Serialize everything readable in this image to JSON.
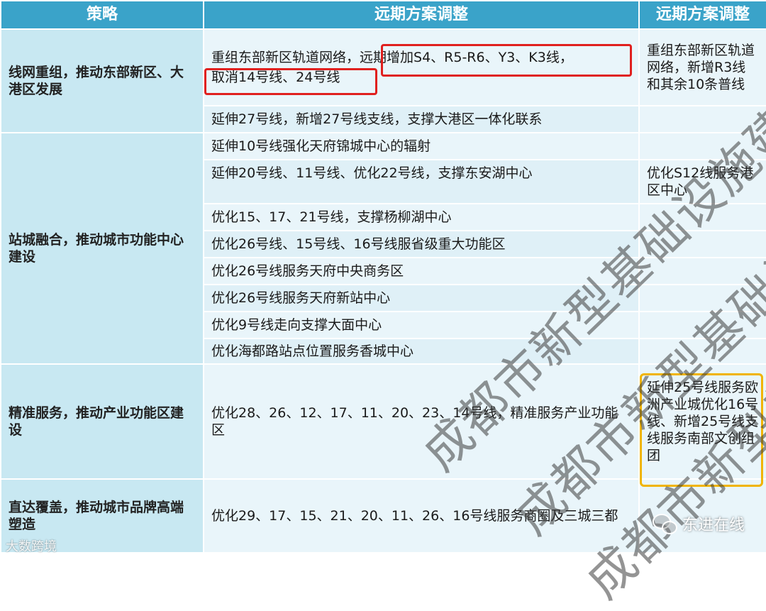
{
  "header": {
    "col1": "策略",
    "col2": "远期方案调整",
    "col3": "远期方案调整"
  },
  "sections": [
    {
      "strategy": "线网重组，推动东部新区、大港区发展",
      "rows": [
        {
          "mid_a": "重组东部新区轨道网络，",
          "mid_b": "远期增加S4、R5-R6、Y3、K3线，",
          "mid_c": "取消14号线、24号线"
        },
        {
          "mid": "延伸27号线，新增27号线支线，支撑大港区一体化联系"
        }
      ],
      "right": "重组东部新区轨道网络，新增R3线和其余10条普线"
    },
    {
      "strategy": "站城融合，推动城市功能中心建设",
      "rows": [
        {
          "mid": "延伸10号线强化天府锦城中心的辐射",
          "right": ""
        },
        {
          "mid": "延伸20号线、11号线、优化22号线，支撑东安湖中心",
          "right": "优化S12线服务港区中心"
        },
        {
          "mid": "优化15、17、21号线，支撑杨柳湖中心",
          "right": ""
        },
        {
          "mid": "优化26号线、15号线、16号线服省级重大功能区",
          "right": ""
        },
        {
          "mid": "优化26号线服务天府中央商务区",
          "right": ""
        },
        {
          "mid": "优化26号线服务天府新站中心",
          "right": ""
        },
        {
          "mid": "优化9号线走向支撑大面中心",
          "right": ""
        },
        {
          "mid": "优化海都路站点位置服务香城中心",
          "right": ""
        }
      ]
    },
    {
      "strategy": "精准服务，推动产业功能区建设",
      "mid": "优化28、26、12、17、11、20、23、14号线，精准服务产业功能区",
      "right": "延伸25号线服务欧洲产业城优化16号线、新增25号线支线服务南部文创组团"
    },
    {
      "strategy": "直达覆盖，推动城市品牌高端塑造",
      "mid": "优化29、17、15、21、20、11、26、16号线服务商圈及三城三都",
      "right": ""
    }
  ],
  "watermark": "成都市新型基础设施建设",
  "badge": {
    "label": "东进在线",
    "icon": "wechat-icon"
  },
  "source": "大数跨境",
  "colors": {
    "header": "#3aa3c9",
    "strategy_bg": "#c8e8f2",
    "cell_bg": "#e9f5fa",
    "red_highlight": "#e0201e",
    "orange_highlight": "#f0b400"
  }
}
